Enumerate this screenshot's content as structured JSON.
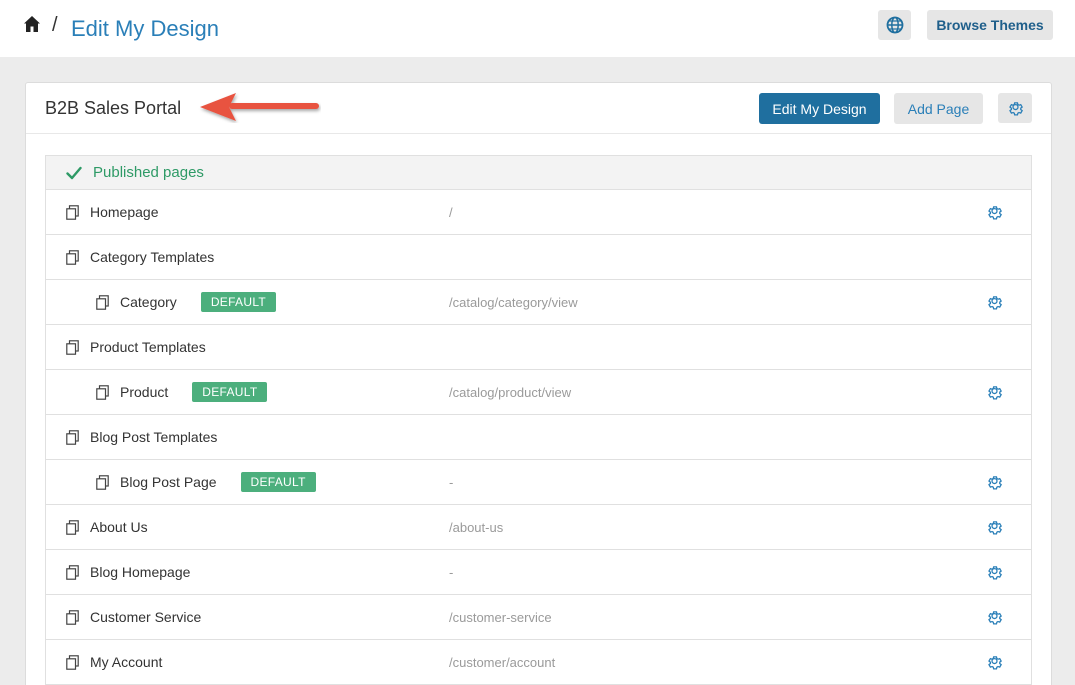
{
  "header": {
    "separator": "/",
    "title": "Edit My Design",
    "browse_themes_label": "Browse Themes",
    "icons": {
      "home": "home-icon",
      "globe": "globe-icon"
    }
  },
  "card": {
    "site_name": "B2B Sales Portal",
    "edit_design_label": "Edit My Design",
    "add_page_label": "Add Page",
    "annotation": "red-arrow pointing at site name"
  },
  "section": {
    "label": "Published pages"
  },
  "rows": [
    {
      "name": "Homepage",
      "url": "/",
      "badge": "",
      "indent": false,
      "has_gear": true
    },
    {
      "name": "Category Templates",
      "url": "",
      "badge": "",
      "indent": false,
      "has_gear": false
    },
    {
      "name": "Category",
      "url": "/catalog/category/view",
      "badge": "DEFAULT",
      "indent": true,
      "has_gear": true
    },
    {
      "name": "Product Templates",
      "url": "",
      "badge": "",
      "indent": false,
      "has_gear": false
    },
    {
      "name": "Product",
      "url": "/catalog/product/view",
      "badge": "DEFAULT",
      "indent": true,
      "has_gear": true
    },
    {
      "name": "Blog Post Templates",
      "url": "",
      "badge": "",
      "indent": false,
      "has_gear": false
    },
    {
      "name": "Blog Post Page",
      "url": "-",
      "badge": "DEFAULT",
      "indent": true,
      "has_gear": true
    },
    {
      "name": "About Us",
      "url": "/about-us",
      "badge": "",
      "indent": false,
      "has_gear": true
    },
    {
      "name": "Blog Homepage",
      "url": "-",
      "badge": "",
      "indent": false,
      "has_gear": true
    },
    {
      "name": "Customer Service",
      "url": "/customer-service",
      "badge": "",
      "indent": false,
      "has_gear": true
    },
    {
      "name": "My Account",
      "url": "/customer/account",
      "badge": "",
      "indent": false,
      "has_gear": true
    }
  ],
  "colors": {
    "accent": "#2a7fb8",
    "primary_button": "#1f6f9f",
    "badge": "#4caf7d",
    "published": "#2e9a66",
    "arrow": "#e8523f"
  }
}
